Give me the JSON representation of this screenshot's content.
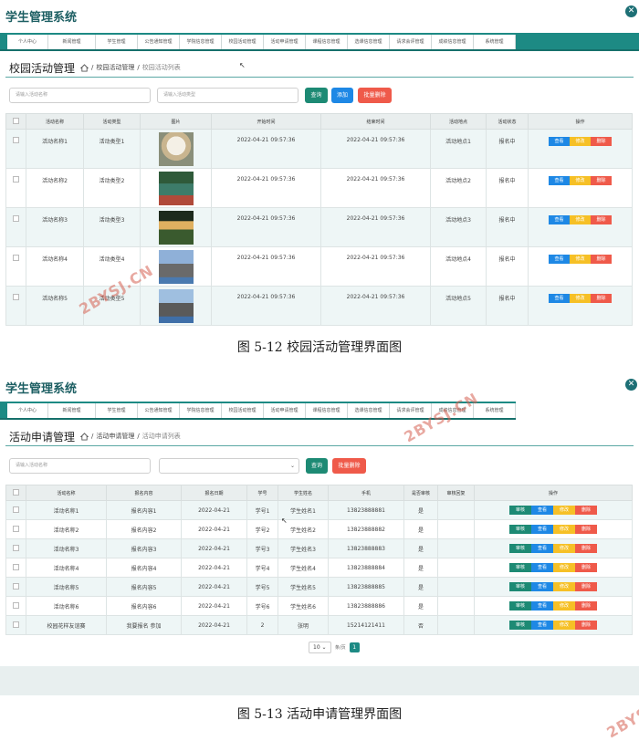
{
  "screen1": {
    "app_title": "学生管理系统",
    "nav": [
      "个人中心",
      "新闻管理",
      "学生管理",
      "公告通知管理",
      "学院信息管理",
      "校园活动管理",
      "活动申请管理",
      "课程信息管理",
      "选课信息管理",
      "请求会评管理",
      "成绩信息管理",
      "系统管理"
    ],
    "page_title": "校园活动管理",
    "breadcrumb": {
      "sep": "/",
      "level1": "校园活动管理",
      "level2": "校园活动列表"
    },
    "search1_placeholder": "请输入活动名称",
    "search2_placeholder": "请输入活动类型",
    "btn_query": "查询",
    "btn_add": "添加",
    "btn_batch_delete": "批量删除",
    "columns": [
      "活动名称",
      "活动类型",
      "图片",
      "开始时间",
      "结束时间",
      "活动地点",
      "活动状态",
      "操作"
    ],
    "rows": [
      {
        "name": "活动名称1",
        "type": "活动类型1",
        "start": "2022-04-21 09:57:36",
        "end": "2022-04-21 09:57:36",
        "place": "活动地点1",
        "status": "报名中"
      },
      {
        "name": "活动名称2",
        "type": "活动类型2",
        "start": "2022-04-21 09:57:36",
        "end": "2022-04-21 09:57:36",
        "place": "活动地点2",
        "status": "报名中"
      },
      {
        "name": "活动名称3",
        "type": "活动类型3",
        "start": "2022-04-21 09:57:36",
        "end": "2022-04-21 09:57:36",
        "place": "活动地点3",
        "status": "报名中"
      },
      {
        "name": "活动名称4",
        "type": "活动类型4",
        "start": "2022-04-21 09:57:36",
        "end": "2022-04-21 09:57:36",
        "place": "活动地点4",
        "status": "报名中"
      },
      {
        "name": "活动名称5",
        "type": "活动类型5",
        "start": "2022-04-21 09:57:36",
        "end": "2022-04-21 09:57:36",
        "place": "活动地点5",
        "status": "报名中"
      }
    ],
    "op_labels": {
      "view": "查看",
      "edit": "修改",
      "delete": "删除"
    }
  },
  "caption1": "图 5-12 校园活动管理界面图",
  "screen2": {
    "app_title": "学生管理系统",
    "nav": [
      "个人中心",
      "新闻管理",
      "学生管理",
      "公告通知管理",
      "学院信息管理",
      "校园活动管理",
      "活动申请管理",
      "课程信息管理",
      "选课信息管理",
      "请求会评管理",
      "成绩信息管理",
      "系统管理"
    ],
    "page_title": "活动申请管理",
    "breadcrumb": {
      "sep": "/",
      "level1": "活动申请管理",
      "level2": "活动申请列表"
    },
    "search_placeholder": "请输入活动名称",
    "select_value": "",
    "btn_query": "查询",
    "btn_batch_delete": "批量删除",
    "columns": [
      "活动名称",
      "报名内容",
      "报名日期",
      "学号",
      "学生姓名",
      "手机",
      "是否审核",
      "审核回复",
      "操作"
    ],
    "rows": [
      {
        "name": "活动名称1",
        "content": "报名内容1",
        "date": "2022-04-21",
        "sid": "学号1",
        "sname": "学生姓名1",
        "phone": "13823888881",
        "audit": "是",
        "reply": ""
      },
      {
        "name": "活动名称2",
        "content": "报名内容2",
        "date": "2022-04-21",
        "sid": "学号2",
        "sname": "学生姓名2",
        "phone": "13823888882",
        "audit": "是",
        "reply": ""
      },
      {
        "name": "活动名称3",
        "content": "报名内容3",
        "date": "2022-04-21",
        "sid": "学号3",
        "sname": "学生姓名3",
        "phone": "13823888883",
        "audit": "是",
        "reply": ""
      },
      {
        "name": "活动名称4",
        "content": "报名内容4",
        "date": "2022-04-21",
        "sid": "学号4",
        "sname": "学生姓名4",
        "phone": "13823888884",
        "audit": "是",
        "reply": ""
      },
      {
        "name": "活动名称5",
        "content": "报名内容5",
        "date": "2022-04-21",
        "sid": "学号5",
        "sname": "学生姓名5",
        "phone": "13823888885",
        "audit": "是",
        "reply": ""
      },
      {
        "name": "活动名称6",
        "content": "报名内容6",
        "date": "2022-04-21",
        "sid": "学号6",
        "sname": "学生姓名6",
        "phone": "13823888886",
        "audit": "是",
        "reply": ""
      },
      {
        "name": "校园花样友谊赛",
        "content": "我要报名 参加",
        "date": "2022-04-21",
        "sid": "2",
        "sname": "张明",
        "phone": "15214121411",
        "audit": "否",
        "reply": ""
      }
    ],
    "op_labels": {
      "audit": "审核",
      "view": "查看",
      "edit": "修改",
      "delete": "删除"
    },
    "pager": {
      "page_size": "10",
      "size_label": "条/页",
      "current_page": "1"
    }
  },
  "caption2": "图 5-13 活动申请管理界面图",
  "watermark_text": "2BYSJ.CN",
  "colors": {
    "primary": "#1d8a84",
    "blue": "#1e88e5",
    "yellow": "#f6c026",
    "red": "#ef5a4a",
    "green": "#1d8a74"
  }
}
